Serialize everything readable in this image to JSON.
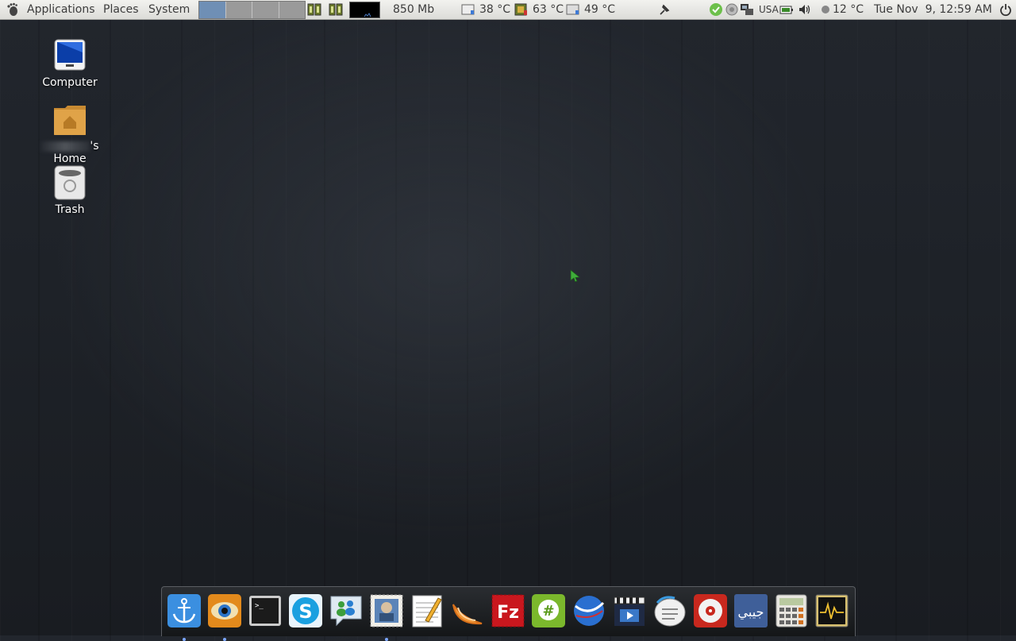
{
  "panel": {
    "menus": {
      "applications": "Applications",
      "places": "Places",
      "system": "System"
    },
    "memory": "850 Mb",
    "temps": [
      "38 °C",
      "63 °C",
      "49 °C"
    ],
    "keyboard_layout": "USA",
    "weather": "12 °C",
    "clock": "Tue Nov  9, 12:59 AM",
    "workspaces": {
      "count": 4,
      "active_index": 0
    }
  },
  "desktop": {
    "icons": [
      {
        "label": "Computer",
        "icon": "computer-icon"
      },
      {
        "label": "'s Home",
        "icon": "home-folder-icon"
      },
      {
        "label": "Trash",
        "icon": "trash-icon"
      }
    ]
  },
  "dock": {
    "items": [
      {
        "icon": "anchor-icon",
        "running": true
      },
      {
        "icon": "eye-icon",
        "running": true
      },
      {
        "icon": "terminal-icon",
        "running": false
      },
      {
        "icon": "skype-icon",
        "running": false
      },
      {
        "icon": "messenger-icon",
        "running": false
      },
      {
        "icon": "mail-stamp-icon",
        "running": true
      },
      {
        "icon": "text-editor-icon",
        "running": false
      },
      {
        "icon": "orange-slice-icon",
        "running": false
      },
      {
        "icon": "filezilla-icon",
        "running": false
      },
      {
        "icon": "hashtag-icon",
        "running": false
      },
      {
        "icon": "globe-icon",
        "running": false
      },
      {
        "icon": "video-clapper-icon",
        "running": false
      },
      {
        "icon": "chat-bubble-icon",
        "running": false
      },
      {
        "icon": "disc-icon",
        "running": false
      },
      {
        "icon": "arabic-app-icon",
        "running": false
      },
      {
        "icon": "calculator-icon",
        "running": false
      },
      {
        "icon": "system-monitor-icon",
        "running": false
      }
    ],
    "arabic_label": "جيبي"
  },
  "colors": {
    "workspace_active": "#6f8fb5",
    "dock_dot": "#7aa6ff",
    "cursor": "#3fae3a"
  }
}
